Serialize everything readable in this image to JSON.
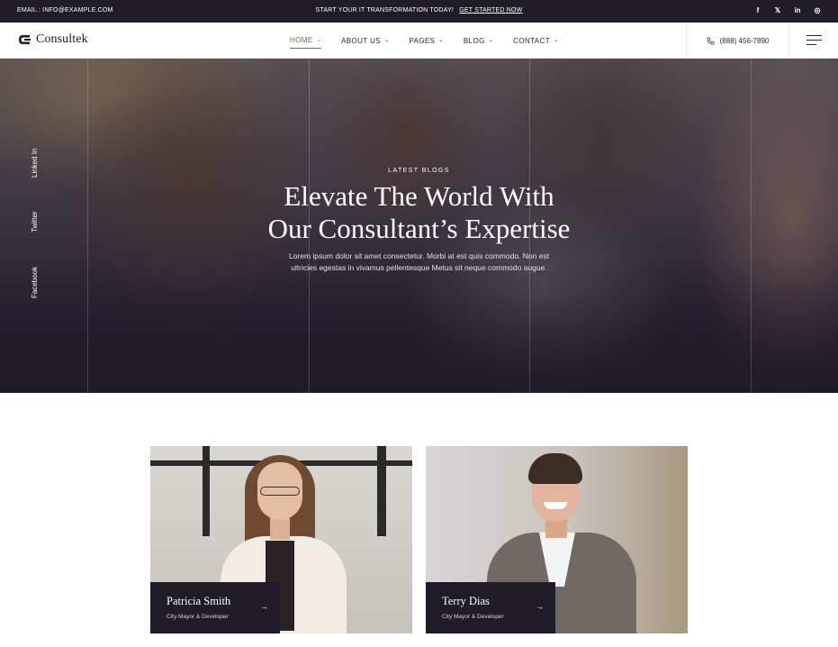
{
  "topbar": {
    "email": "EMAIL : INFO@EXAMPLE.COM",
    "promo_text": "START YOUR IT TRANSFORMATION TODAY!",
    "promo_link": "GET STARTED NOW",
    "social": [
      {
        "icon": "facebook-icon",
        "glyph": "f"
      },
      {
        "icon": "x-icon",
        "glyph": "𝕏"
      },
      {
        "icon": "linkedin-icon",
        "glyph": "in"
      },
      {
        "icon": "instagram-icon",
        "glyph": "◎"
      }
    ]
  },
  "header": {
    "logo_text": "Consultek",
    "nav": [
      {
        "label": "HOME",
        "active": true
      },
      {
        "label": "ABOUT US",
        "active": false
      },
      {
        "label": "PAGES",
        "active": false
      },
      {
        "label": "BLOG",
        "active": false
      },
      {
        "label": "CONTACT",
        "active": false
      }
    ],
    "phone": "(888) 456-7890"
  },
  "hero": {
    "side_social": [
      "Linked In",
      "Twitter",
      "Facebook"
    ],
    "kicker": "LATEST BLOGS",
    "title_line1": "Elevate The World With",
    "title_line2": "Our Consultant’s Expertise",
    "desc_line1": "Lorem ipsum dolor sit amet consectetur. Morbi at est quis commodo. Non est",
    "desc_line2": "ultricies egestas in vivamus pellentesque Metus sit neque commodo augue."
  },
  "team": [
    {
      "name": "Patricia Smith",
      "role": "City Mayor & Developer"
    },
    {
      "name": "Terry Dias",
      "role": "City Mayor & Developer"
    }
  ],
  "colors": {
    "dark": "#1f1b29",
    "accent": "#8b5a52"
  }
}
